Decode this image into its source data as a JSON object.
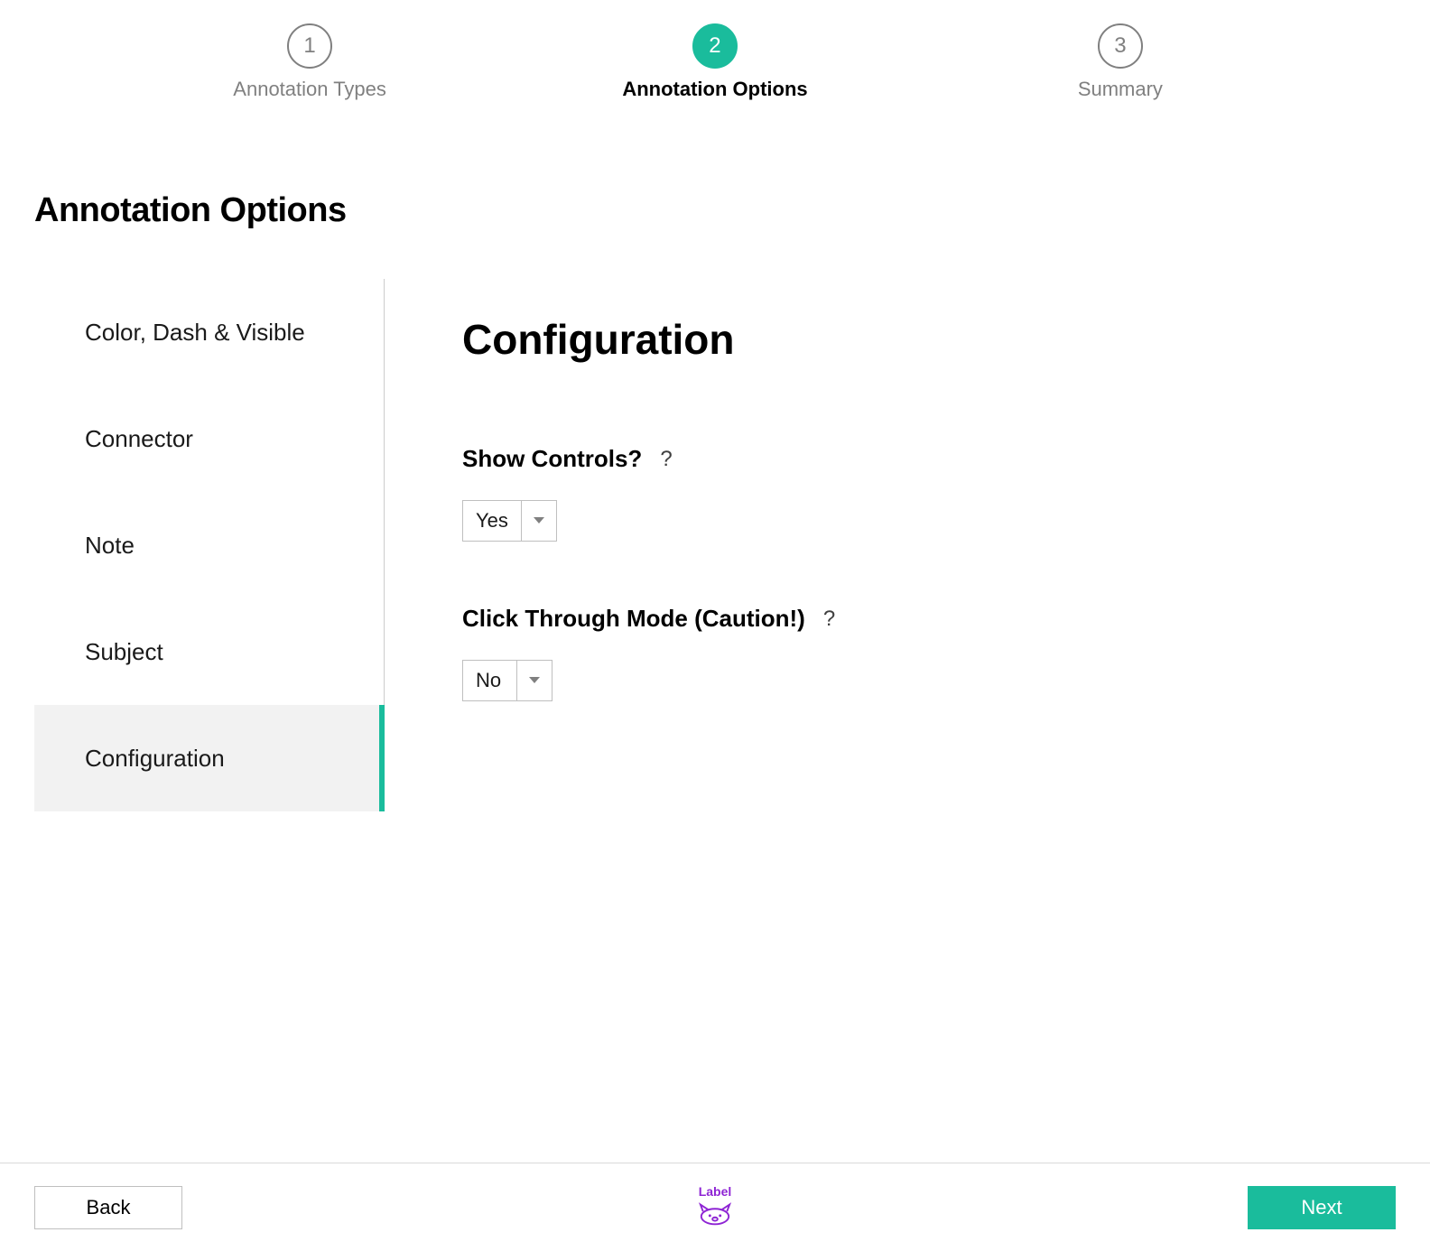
{
  "stepper": {
    "steps": [
      {
        "number": "1",
        "label": "Annotation Types"
      },
      {
        "number": "2",
        "label": "Annotation Options"
      },
      {
        "number": "3",
        "label": "Summary"
      }
    ],
    "active_index": 1
  },
  "page_title": "Annotation Options",
  "sidebar": {
    "items": [
      {
        "label": "Color, Dash & Visible"
      },
      {
        "label": "Connector"
      },
      {
        "label": "Note"
      },
      {
        "label": "Subject"
      },
      {
        "label": "Configuration"
      }
    ],
    "active_index": 4
  },
  "panel": {
    "title": "Configuration",
    "fields": [
      {
        "label": "Show Controls?",
        "help": "?",
        "value": "Yes"
      },
      {
        "label": "Click Through Mode (Caution!)",
        "help": "?",
        "value": "No"
      }
    ]
  },
  "footer": {
    "back_label": "Back",
    "next_label": "Next",
    "brand_label": "Label"
  }
}
